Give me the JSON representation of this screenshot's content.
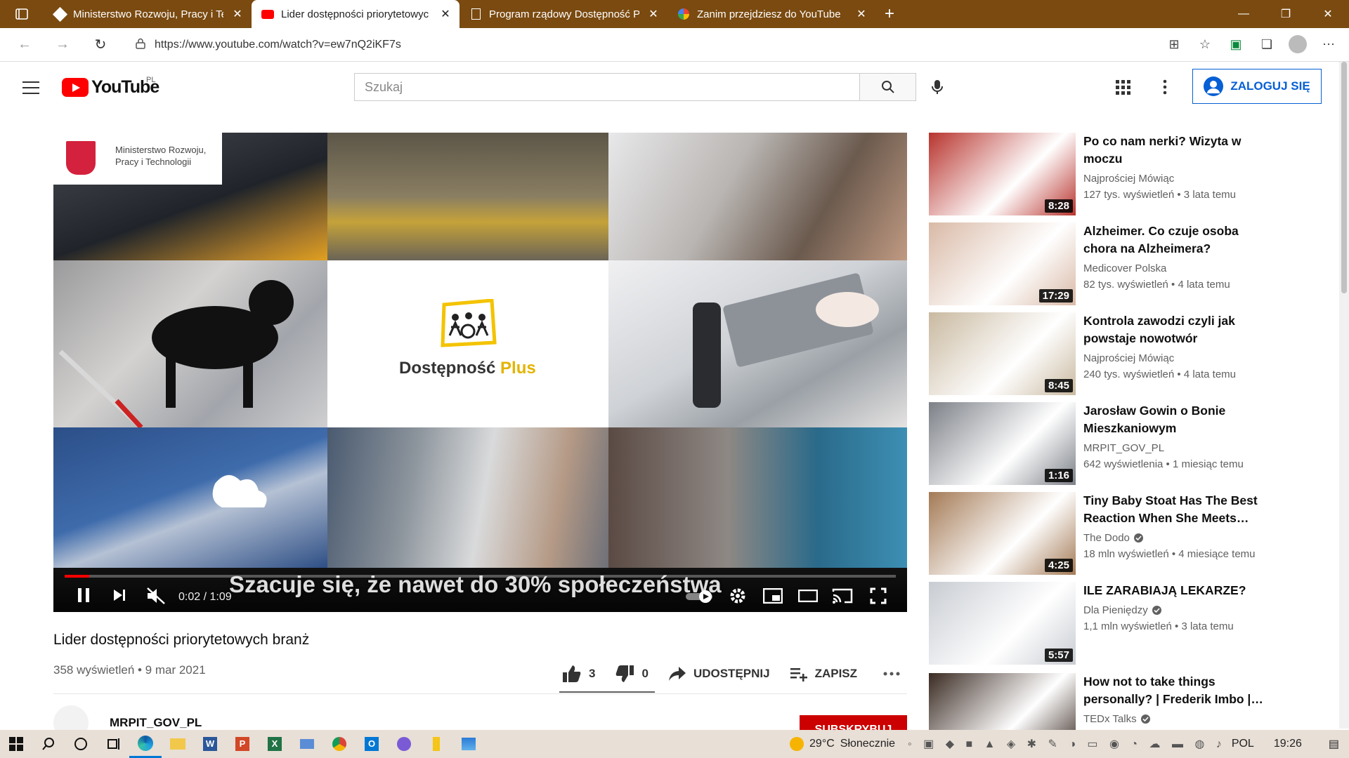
{
  "browser": {
    "tabs": [
      {
        "title": "Ministerstwo Rozwoju, Pracy i Te",
        "icon": "ministry-icon",
        "active": false
      },
      {
        "title": "Lider dostępności priorytetowyc",
        "icon": "youtube-icon",
        "active": true
      },
      {
        "title": "Program rządowy Dostępność Pl",
        "icon": "document-icon",
        "active": false
      },
      {
        "title": "Zanim przejdziesz do YouTube",
        "icon": "google-icon",
        "active": false
      }
    ],
    "url": "https://www.youtube.com/watch?v=ew7nQ2iKF7s"
  },
  "header": {
    "logo_text": "YouTube",
    "region": "PL",
    "search_placeholder": "Szukaj",
    "signin_label": "ZALOGUJ SIĘ"
  },
  "player": {
    "ministry_line1": "Ministerstwo Rozwoju,",
    "ministry_line2": "Pracy i Technologii",
    "center_logo_main": "Dostępność",
    "center_logo_accent": "Plus",
    "subtitle": "Szacuje się, że nawet do 30% społeczeństwa",
    "time": "0:02 / 1:09",
    "progress": 0.03
  },
  "video": {
    "title": "Lider dostępności priorytetowych branż",
    "meta": "358 wyświetleń • 9 mar 2021",
    "likes": "3",
    "dislikes": "0",
    "share_label": "UDOSTĘPNIJ",
    "save_label": "ZAPISZ",
    "channel": "MRPIT_GOV_PL",
    "subscribe_label": "SUBSKRYBUJ"
  },
  "recommendations": [
    {
      "title": "Po co nam nerki? Wizyta w moczu",
      "channel": "Najprościej Mówiąc",
      "verified": false,
      "views": "127 tys. wyświetleń • 3 lata temu",
      "duration": "8:28",
      "color": "#b8342e"
    },
    {
      "title": "Alzheimer. Co czuje osoba chora na Alzheimera?",
      "channel": "Medicover Polska",
      "verified": false,
      "views": "82 tys. wyświetleń • 4 lata temu",
      "duration": "17:29",
      "color": "#d9b9a6"
    },
    {
      "title": "Kontrola zawodzi czyli jak powstaje nowotwór",
      "channel": "Najprościej Mówiąc",
      "verified": false,
      "views": "240 tys. wyświetleń • 4 lata temu",
      "duration": "8:45",
      "color": "#c9b9a0"
    },
    {
      "title": "Jarosław Gowin o Bonie Mieszkaniowym",
      "channel": "MRPIT_GOV_PL",
      "verified": false,
      "views": "642 wyświetlenia • 1 miesiąc temu",
      "duration": "1:16",
      "color": "#7c8087"
    },
    {
      "title": "Tiny Baby Stoat Has The Best Reaction When She Meets…",
      "channel": "The Dodo",
      "verified": true,
      "views": "18 mln wyświetleń • 4 miesiące temu",
      "duration": "4:25",
      "color": "#a47a55"
    },
    {
      "title": "ILE ZARABIAJĄ LEKARZE?",
      "channel": "Dla Pieniędzy",
      "verified": true,
      "views": "1,1 mln wyświetleń • 3 lata temu",
      "duration": "5:57",
      "color": "#c8ccd2"
    },
    {
      "title": "How not to take things personally? | Frederik Imbo |…",
      "channel": "TEDx Talks",
      "verified": true,
      "views": "",
      "duration": "",
      "color": "#3a2a22"
    }
  ],
  "taskbar": {
    "temperature": "29°C",
    "weather": "Słonecznie",
    "language": "POL",
    "clock": "19:26"
  }
}
